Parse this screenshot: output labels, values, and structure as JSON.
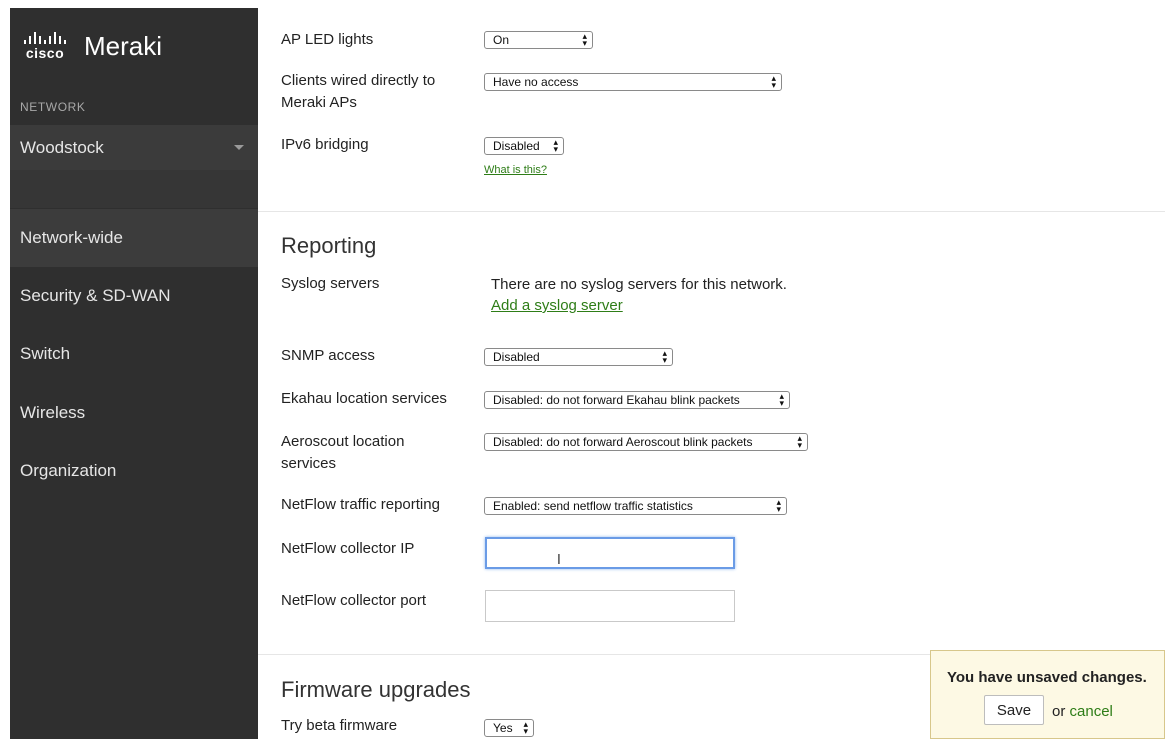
{
  "brand": {
    "logo_text": "cisco",
    "product": "Meraki"
  },
  "sidebar": {
    "section_label": "NETWORK",
    "network": "Woodstock",
    "items": [
      {
        "label": "Network-wide",
        "active": true
      },
      {
        "label": "Security & SD-WAN",
        "active": false
      },
      {
        "label": "Switch",
        "active": false
      },
      {
        "label": "Wireless",
        "active": false
      },
      {
        "label": "Organization",
        "active": false
      }
    ]
  },
  "general": {
    "ap_led": {
      "label": "AP LED lights",
      "value": "On"
    },
    "clients_wired": {
      "label_line1": "Clients wired directly to",
      "label_line2": "Meraki APs",
      "value": "Have no access"
    },
    "ipv6": {
      "label": "IPv6 bridging",
      "value": "Disabled",
      "help_link": "What is this?"
    }
  },
  "reporting": {
    "title": "Reporting",
    "syslog": {
      "label": "Syslog servers",
      "empty_text": "There are no syslog servers for this network.",
      "add_link": "Add a syslog server"
    },
    "snmp": {
      "label": "SNMP access",
      "value": "Disabled"
    },
    "ekahau": {
      "label": "Ekahau location services",
      "value": "Disabled: do not forward Ekahau blink packets"
    },
    "aeroscout": {
      "label_line1": "Aeroscout location",
      "label_line2": "services",
      "value": "Disabled: do not forward Aeroscout blink packets"
    },
    "netflow": {
      "label": "NetFlow traffic reporting",
      "value": "Enabled: send netflow traffic statistics"
    },
    "collector_ip": {
      "label": "NetFlow collector IP",
      "value": ""
    },
    "collector_port": {
      "label": "NetFlow collector port",
      "value": ""
    }
  },
  "firmware": {
    "title": "Firmware upgrades",
    "beta": {
      "label": "Try beta firmware",
      "value": "Yes"
    }
  },
  "unsaved": {
    "message": "You have unsaved changes.",
    "save_label": "Save",
    "or_text": "or",
    "cancel_label": "cancel"
  },
  "colors": {
    "sidebar_bg": "#2f2f2f",
    "link_green": "#2e7d17",
    "focus_blue": "#6a9be6",
    "notice_bg": "#fdf9e4"
  }
}
